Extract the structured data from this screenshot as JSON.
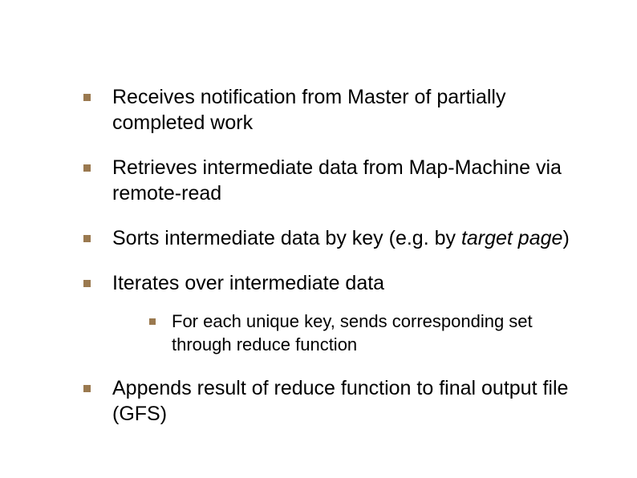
{
  "bullets": {
    "b0": "Receives notification from Master of partially completed work",
    "b1": "Retrieves intermediate data from Map-Machine via remote-read",
    "b2_pre": "Sorts intermediate data by key (e.g. by ",
    "b2_em": "target page",
    "b2_post": ")",
    "b3": "Iterates over intermediate data",
    "b3_sub0": "For each unique key, sends corresponding set through reduce function",
    "b4": "Appends result of reduce function to final output file (GFS)"
  }
}
